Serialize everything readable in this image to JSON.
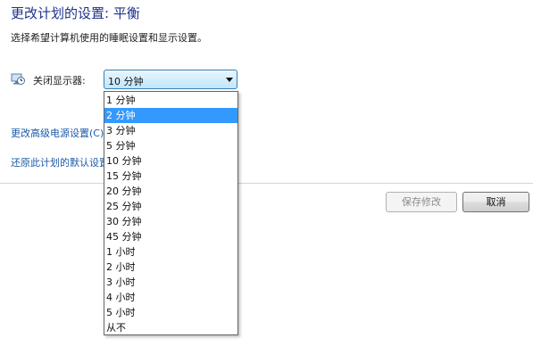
{
  "header": {
    "title": "更改计划的设置: 平衡",
    "subtitle": "选择希望计算机使用的睡眠设置和显示设置。"
  },
  "display_off": {
    "label": "关闭显示器:",
    "selected_value": "10 分钟",
    "icon": "monitor-clock-icon",
    "options": [
      {
        "label": "1 分钟",
        "highlighted": false
      },
      {
        "label": "2 分钟",
        "highlighted": true
      },
      {
        "label": "3 分钟",
        "highlighted": false
      },
      {
        "label": "5 分钟",
        "highlighted": false
      },
      {
        "label": "10 分钟",
        "highlighted": false
      },
      {
        "label": "15 分钟",
        "highlighted": false
      },
      {
        "label": "20 分钟",
        "highlighted": false
      },
      {
        "label": "25 分钟",
        "highlighted": false
      },
      {
        "label": "30 分钟",
        "highlighted": false
      },
      {
        "label": "45 分钟",
        "highlighted": false
      },
      {
        "label": "1 小时",
        "highlighted": false
      },
      {
        "label": "2 小时",
        "highlighted": false
      },
      {
        "label": "3 小时",
        "highlighted": false
      },
      {
        "label": "4 小时",
        "highlighted": false
      },
      {
        "label": "5 小时",
        "highlighted": false
      },
      {
        "label": "从不",
        "highlighted": false
      }
    ]
  },
  "links": {
    "advanced": "更改高级电源设置(C)",
    "restore": "还原此计划的默认设置"
  },
  "buttons": {
    "save": "保存修改",
    "save_enabled": false,
    "cancel": "取消"
  },
  "colors": {
    "title": "#1e3287",
    "link": "#1c5aa7",
    "highlight": "#3399ff"
  }
}
